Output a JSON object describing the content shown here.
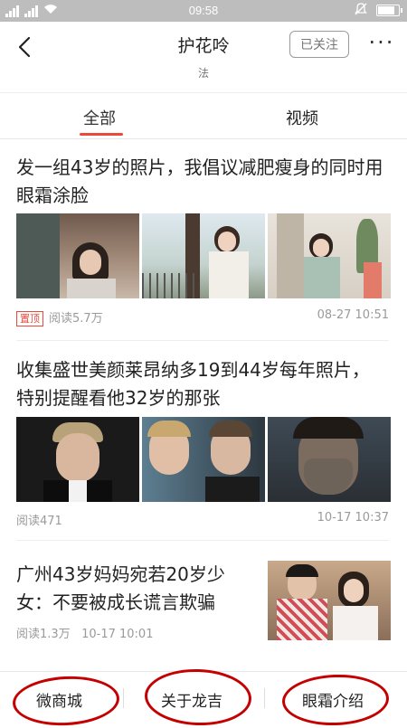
{
  "status_bar": {
    "time": "09:58"
  },
  "header": {
    "title": "护花呤",
    "subtitle": "法",
    "follow_label": "已关注",
    "more_label": "···"
  },
  "tabs": [
    {
      "label": "全部"
    },
    {
      "label": "视频"
    }
  ],
  "articles": [
    {
      "title": "发一组43岁的照片，我倡议减肥瘦身的同时用眼霜涂脸",
      "badge": "置顶",
      "reads": "阅读5.7万",
      "time": "08-27 10:51"
    },
    {
      "title": "收集盛世美颜莱昂纳多19到44岁每年照片，特别提醒看他32岁的那张",
      "reads": "阅读471",
      "time": "10-17 10:37"
    },
    {
      "title": "广州43岁妈妈宛若20岁少女：不要被成长谎言欺骗",
      "reads": "阅读1.3万",
      "time": "10-17 10:01"
    }
  ],
  "bottom_bar": [
    {
      "label": "微商城"
    },
    {
      "label": "关于龙吉"
    },
    {
      "label": "眼霜介绍"
    }
  ],
  "colors": {
    "accent": "#e84a3c",
    "annotation_circle": "#c40000",
    "status_bar_bg": "#bdbdbd"
  }
}
